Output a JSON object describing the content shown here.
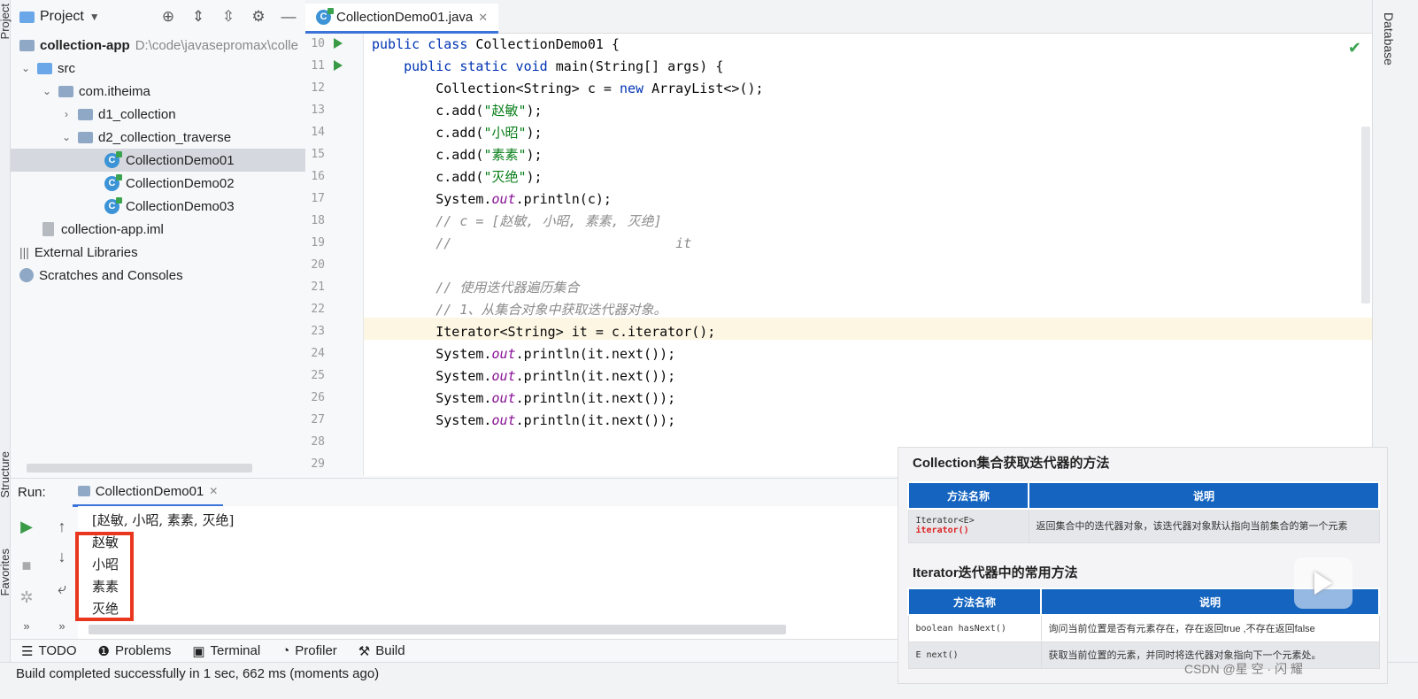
{
  "left_strip": {
    "top_label": "Project",
    "mid_label": "Structure",
    "bottom_label": "Favorites"
  },
  "project": {
    "title": "Project",
    "tree": [
      {
        "label": "collection-app",
        "extra": "D:\\code\\javasepromax\\colle",
        "level": 0,
        "bold": true
      },
      {
        "label": "src",
        "level": 1,
        "expanded": true
      },
      {
        "label": "com.itheima",
        "level": 2,
        "expanded": true
      },
      {
        "label": "d1_collection",
        "level": 3,
        "expanded": false
      },
      {
        "label": "d2_collection_traverse",
        "level": 3,
        "expanded": true
      },
      {
        "label": "CollectionDemo01",
        "level": 4,
        "selected": true
      },
      {
        "label": "CollectionDemo02",
        "level": 4
      },
      {
        "label": "CollectionDemo03",
        "level": 4
      },
      {
        "label": "collection-app.iml",
        "level": 1
      },
      {
        "label": "External Libraries",
        "level": 0
      },
      {
        "label": "Scratches and Consoles",
        "level": 0
      }
    ]
  },
  "editor": {
    "tab_label": "CollectionDemo01.java",
    "line_numbers": [
      "10",
      "11",
      "12",
      "13",
      "14",
      "15",
      "16",
      "17",
      "18",
      "19",
      "20",
      "21",
      "22",
      "23",
      "24",
      "25",
      "26",
      "27",
      "28",
      "29"
    ],
    "current_line": "23"
  },
  "right_strip": {
    "label": "Database"
  },
  "run": {
    "label": "Run:",
    "tab": "CollectionDemo01",
    "output": [
      "[赵敏, 小昭, 素素, 灭绝]",
      "赵敏",
      "小昭",
      "素素",
      "灭绝"
    ]
  },
  "bottom_tabs": [
    "TODO",
    "Problems",
    "Terminal",
    "Profiler",
    "Build"
  ],
  "status": "Build completed successfully in 1 sec, 662 ms (moments ago)",
  "slide": {
    "title1": "Collection集合获取迭代器的方法",
    "table1_headers": [
      "方法名称",
      "说明"
    ],
    "table1_row": {
      "method_prefix": "Iterator<E> ",
      "method_name": "iterator()",
      "desc": "返回集合中的迭代器对象，该迭代器对象默认指向当前集合的第一个元素"
    },
    "title2": "Iterator迭代器中的常用方法",
    "table2_headers": [
      "方法名称",
      "说明"
    ],
    "table2_rows": [
      {
        "method": "boolean hasNext()",
        "desc": "询问当前位置是否有元素存在，存在返回true ,不存在返回false"
      },
      {
        "method": "E next()",
        "desc": "获取当前位置的元素，并同时将迭代器对象指向下一个元素处。"
      }
    ]
  },
  "watermark": "CSDN @星 空 · 闪 耀"
}
